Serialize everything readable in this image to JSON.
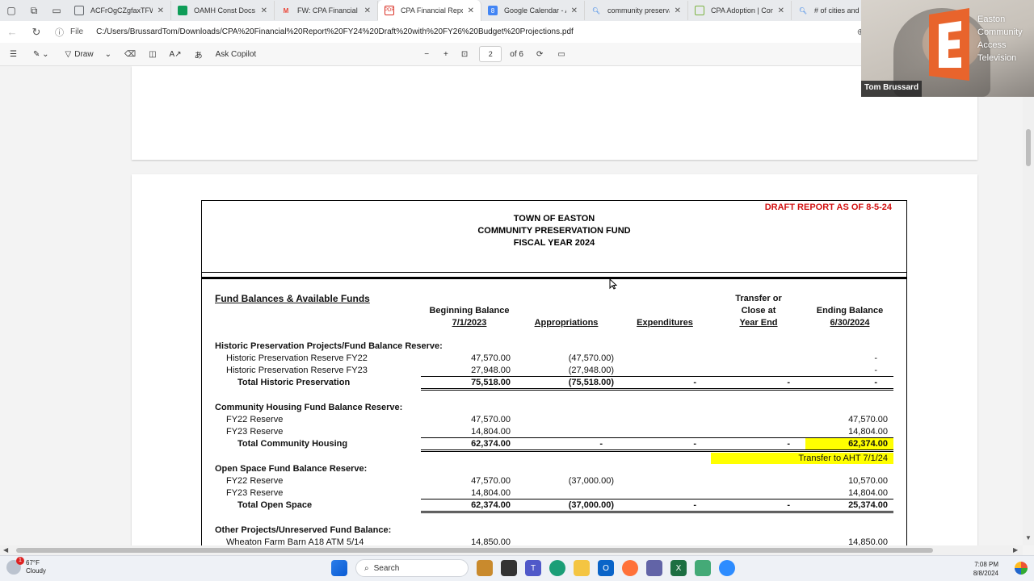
{
  "tabs": [
    {
      "title": "ACFrOgCZgfaxTFWTz",
      "favicon_color": "#5f6368",
      "active": false
    },
    {
      "title": "OAMH Const Docs & Co",
      "favicon_color": "#0f9d58",
      "active": false
    },
    {
      "title": "FW: CPA Financial Report",
      "favicon_color": "#ea4335",
      "active": false
    },
    {
      "title": "CPA Financial Report",
      "favicon_color": "#d93025",
      "active": true
    },
    {
      "title": "Google Calendar - A",
      "favicon_color": "#4285f4",
      "active": false
    },
    {
      "title": "community preservation",
      "favicon_color": "#1a73e8",
      "active": false
    },
    {
      "title": "CPA Adoption | Com",
      "favicon_color": "#7cb342",
      "active": false
    },
    {
      "title": "# of cities and",
      "favicon_color": "#1a73e8",
      "active": false
    }
  ],
  "address": {
    "scheme_label": "File",
    "url": "C:/Users/BrussardTom/Downloads/CPA%20Financial%20Report%20FY24%20Draft%20with%20FY26%20Budget%20Projections.pdf"
  },
  "pdf_toolbar": {
    "draw_label": "Draw",
    "copilot_label": "Ask Copilot",
    "page_current": "2",
    "page_total": "of 6"
  },
  "report": {
    "draft_notice": "DRAFT REPORT AS OF 8-5-24",
    "header_line1": "TOWN OF EASTON",
    "header_line2": "COMMUNITY PRESERVATION FUND",
    "header_line3": "FISCAL YEAR 2024",
    "section_title": "Fund Balances & Available Funds",
    "col_beginning_1": "Beginning Balance",
    "col_beginning_2": "7/1/2023",
    "col_appropriations": "Appropriations",
    "col_expenditures": "Expenditures",
    "col_transfer_1": "Transfer or",
    "col_transfer_2": "Close at",
    "col_transfer_3": "Year End",
    "col_ending_1": "Ending Balance",
    "col_ending_2": "6/30/2024",
    "hp": {
      "title": "Historic Preservation Projects/Fund Balance Reserve:",
      "r1_label": "Historic Preservation Reserve FY22",
      "r1_begin": "47,570.00",
      "r1_approp": "(47,570.00)",
      "r1_end": "-",
      "r2_label": "Historic Preservation Reserve FY23",
      "r2_begin": "27,948.00",
      "r2_approp": "(27,948.00)",
      "r2_end": "-",
      "total_label": "Total Historic Preservation",
      "total_begin": "75,518.00",
      "total_approp": "(75,518.00)",
      "total_exp": "-",
      "total_transfer": "-",
      "total_end": "-"
    },
    "ch": {
      "title": "Community Housing Fund Balance Reserve:",
      "r1_label": "FY22 Reserve",
      "r1_begin": "47,570.00",
      "r1_end": "47,570.00",
      "r2_label": "FY23 Reserve",
      "r2_begin": "14,804.00",
      "r2_end": "14,804.00",
      "total_label": "Total Community Housing",
      "total_begin": "62,374.00",
      "total_approp": "-",
      "total_exp": "-",
      "total_transfer": "-",
      "total_end": "62,374.00",
      "note": "Transfer to AHT 7/1/24"
    },
    "os": {
      "title": "Open Space Fund Balance Reserve:",
      "r1_label": "FY22 Reserve",
      "r1_begin": "47,570.00",
      "r1_approp": "(37,000.00)",
      "r1_end": "10,570.00",
      "r2_label": "FY23 Reserve",
      "r2_begin": "14,804.00",
      "r2_end": "14,804.00",
      "total_label": "Total Open Space",
      "total_begin": "62,374.00",
      "total_approp": "(37,000.00)",
      "total_exp": "-",
      "total_transfer": "-",
      "total_end": "25,374.00"
    },
    "other": {
      "title": "Other Projects/Unreserved Fund Balance:",
      "r1_label": "Wheaton Farm Barn A18 ATM 5/14",
      "r1_begin": "14,850.00",
      "r1_end": "14,850.00"
    }
  },
  "webcam": {
    "brand_line1": "Easton",
    "brand_line2": "Community",
    "brand_line3": "Access",
    "brand_line4": "Television",
    "participant": "Tom Brussard"
  },
  "taskbar": {
    "temperature": "67°F",
    "weather": "Cloudy",
    "notification_count": "1",
    "search_label": "Search",
    "time": "7:08 PM",
    "date": "8/8/2024"
  },
  "colors": {
    "draft_red": "#d21010",
    "highlight_yellow": "#ffff00",
    "cam_logo_orange": "#e8642c"
  }
}
